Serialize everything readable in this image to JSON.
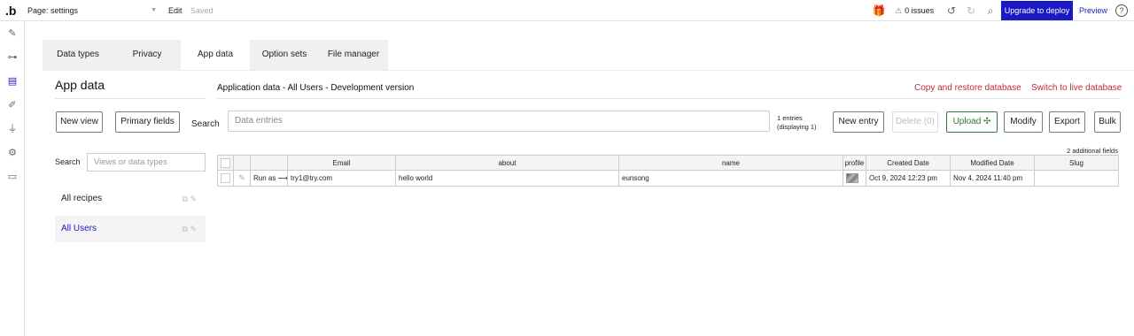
{
  "topbar": {
    "logo": ".b",
    "page_select": "Page: settings",
    "edit": "Edit",
    "saved": "Saved",
    "issues": "0 issues",
    "upgrade": "Upgrade to deploy",
    "preview": "Preview",
    "help": "?"
  },
  "tabs": [
    "Data types",
    "Privacy",
    "App data",
    "Option sets",
    "File manager"
  ],
  "sidebar": {
    "title": "App data",
    "new_view": "New view",
    "primary_fields": "Primary fields",
    "search_label": "Search",
    "search_placeholder": "Views or data types",
    "items": [
      {
        "label": "All recipes"
      },
      {
        "label": "All Users"
      }
    ]
  },
  "main": {
    "title": "Application data - All Users - Development version",
    "copy_restore": "Copy and restore database",
    "switch_live": "Switch to live database",
    "search_label": "Search",
    "search_placeholder": "Data entries",
    "entries_line1": "1 entries",
    "entries_line2": "(displaying 1)",
    "buttons": {
      "new_entry": "New entry",
      "delete": "Delete (0)",
      "upload": "Upload",
      "modify": "Modify",
      "export": "Export",
      "bulk": "Bulk"
    },
    "additional_fields": "2 additional fields"
  },
  "table": {
    "columns": [
      "Email",
      "about",
      "name",
      "profile",
      "Created Date",
      "Modified Date",
      "Slug"
    ],
    "rows": [
      {
        "run_as": "Run as ⟶",
        "email": "try1@try.com",
        "about": "hello world",
        "name": "eunsong",
        "created": "Oct 9, 2024 12:23 pm",
        "modified": "Nov 4, 2024 11:40 pm",
        "slug": ""
      }
    ]
  },
  "colors": {
    "accent": "#1a1ac4",
    "link_red": "#c0283f",
    "upload_green": "#2f7a3a"
  },
  "icons": [
    "gift-icon",
    "warning-icon",
    "undo-icon",
    "redo-icon",
    "search-icon",
    "help-icon",
    "design-icon",
    "workflow-icon",
    "data-icon",
    "styles-icon",
    "plugins-icon",
    "settings-icon",
    "logs-icon",
    "copy-icon",
    "pencil-icon"
  ]
}
